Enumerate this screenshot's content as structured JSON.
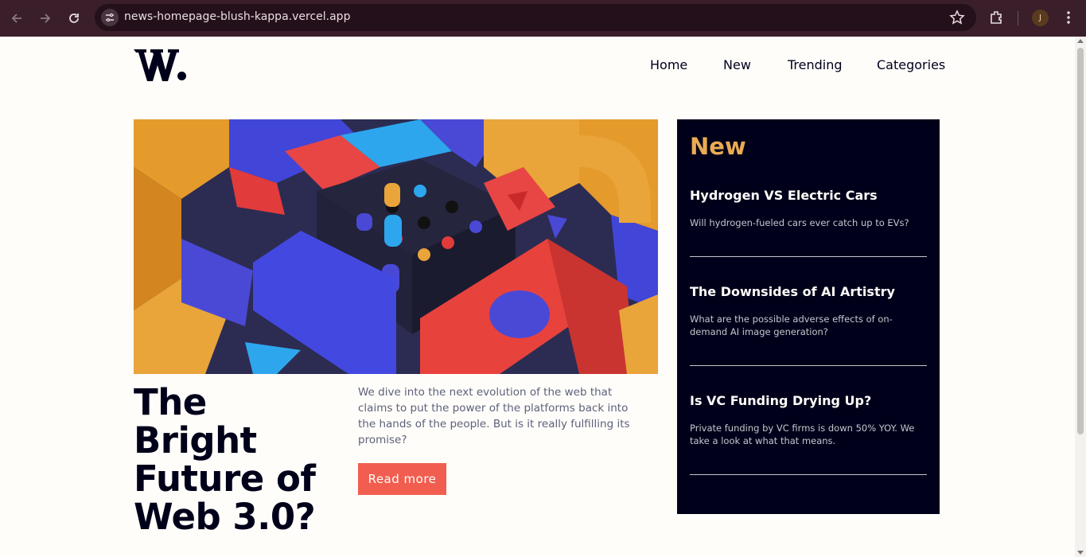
{
  "browser": {
    "url": "news-homepage-blush-kappa.vercel.app",
    "avatar_letter": "J"
  },
  "header": {
    "logo_text": "W.",
    "nav": [
      "Home",
      "New",
      "Trending",
      "Categories"
    ]
  },
  "main": {
    "headline": "The Bright Future of Web 3.0?",
    "lead": "We dive into the next evolution of the web that claims to put the power of the platforms back into the hands of the people. But is it really fulfilling its promise?",
    "read_more_label": "Read more"
  },
  "sidebar": {
    "title": "New",
    "items": [
      {
        "title": "Hydrogen VS Electric Cars",
        "desc": "Will hydrogen-fueled cars ever catch up to EVs?"
      },
      {
        "title": "The Downsides of AI Artistry",
        "desc": "What are the possible adverse effects of on-demand AI image generation?"
      },
      {
        "title": "Is VC Funding Drying Up?",
        "desc": "Private funding by VC firms is down 50% YOY. We take a look at what that means."
      }
    ]
  },
  "colors": {
    "accent_red": "#f15e50",
    "accent_orange": "#e9ab53",
    "dark_navy": "#00001a",
    "off_white": "#fffdfa",
    "grayish_blue": "#5e607a"
  }
}
